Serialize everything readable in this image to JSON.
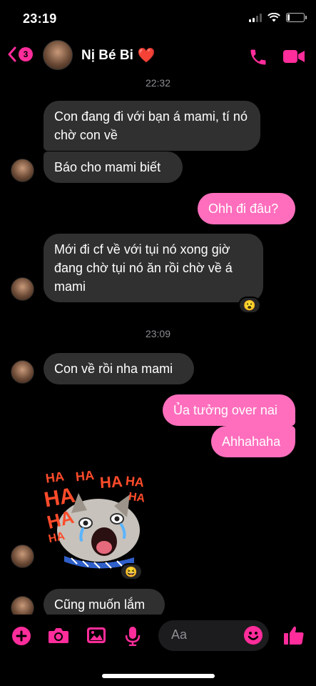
{
  "status_bar": {
    "time": "23:19",
    "battery_level": 0.14,
    "signal_bars": 2
  },
  "header": {
    "unread_count": "3",
    "contact_name": "Nị Bé Bi",
    "heart_emoji": "❤️"
  },
  "chat": {
    "messages": [
      {
        "type": "timestamp",
        "text": "22:32"
      },
      {
        "type": "in",
        "text": "Con đang đi với bạn á mami, tí nó chờ con về"
      },
      {
        "type": "in",
        "text": "Báo cho mami biết"
      },
      {
        "type": "out",
        "text": "Ohh đi đâu?"
      },
      {
        "type": "in",
        "text": "Mới đi cf về với tụi nó xong giờ đang chờ tụi nó ăn rồi chờ về á mami",
        "reaction": "😮"
      },
      {
        "type": "timestamp",
        "text": "23:09"
      },
      {
        "type": "in",
        "text": "Con về rồi nha mami"
      },
      {
        "type": "out",
        "text": "Ủa tưởng over nai"
      },
      {
        "type": "out",
        "text": "Ahhahaha"
      },
      {
        "type": "sticker",
        "sticker_text": [
          "HA",
          "HA",
          "HA",
          "HA",
          "HA",
          "HA",
          "HA",
          "HA"
        ],
        "reaction": "😆"
      },
      {
        "type": "in",
        "text": "Cũng muốn lắm"
      }
    ]
  },
  "composer": {
    "placeholder": "Aa"
  },
  "colors": {
    "accent": "#ff2d9b",
    "outgoing_bubble": "#ff6ebd",
    "incoming_bubble": "#303030",
    "background": "#000000"
  },
  "icons": [
    "back-chevron-icon",
    "phone-icon",
    "video-camera-icon",
    "plus-icon",
    "camera-icon",
    "image-icon",
    "microphone-icon",
    "smiley-icon",
    "thumbs-up-icon"
  ]
}
